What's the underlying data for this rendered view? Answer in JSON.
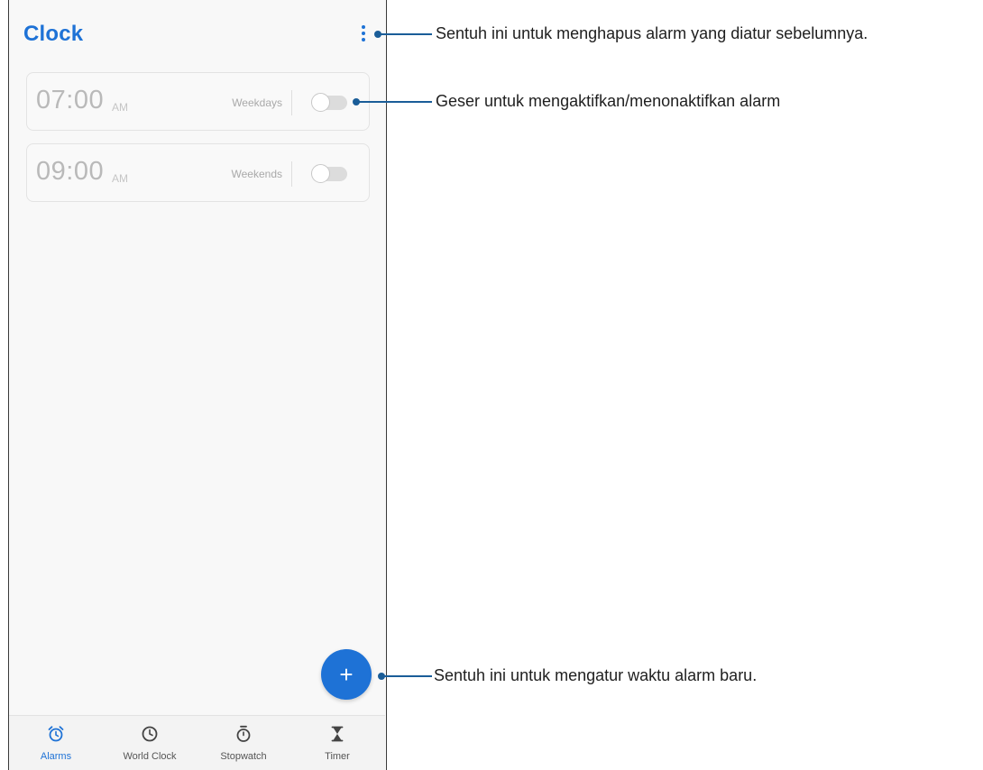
{
  "app": {
    "title": "Clock",
    "accent_color": "#1e72d6",
    "menu_icon": "more-vert-icon"
  },
  "alarms": [
    {
      "time": "07:00",
      "ampm": "AM",
      "days": "Weekdays",
      "enabled": false
    },
    {
      "time": "09:00",
      "ampm": "AM",
      "days": "Weekends",
      "enabled": false
    }
  ],
  "fab": {
    "label": "+",
    "icon": "add-icon"
  },
  "bottom_nav": [
    {
      "label": "Alarms",
      "icon": "alarm-icon",
      "active": true
    },
    {
      "label": "World Clock",
      "icon": "clock-icon",
      "active": false
    },
    {
      "label": "Stopwatch",
      "icon": "stopwatch-icon",
      "active": false
    },
    {
      "label": "Timer",
      "icon": "hourglass-icon",
      "active": false
    }
  ],
  "callouts": [
    {
      "text": "Sentuh ini untuk menghapus alarm yang diatur sebelumnya."
    },
    {
      "text": "Geser untuk mengaktifkan/menonaktifkan alarm"
    },
    {
      "text": "Sentuh ini untuk mengatur waktu alarm baru."
    }
  ]
}
